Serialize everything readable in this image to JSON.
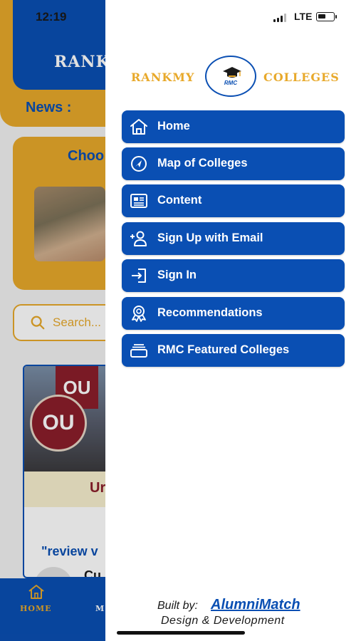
{
  "status_bar": {
    "time": "12:19",
    "network": "LTE",
    "battery_level": 0.55
  },
  "background": {
    "header_logo_text": "RANK",
    "news_label": "News :",
    "choose_text": "Choo",
    "search_placeholder": "Search...",
    "college_flag_text": "OU",
    "college_logo_text": "OU",
    "college_name": "Ur",
    "review_text": "\"review v",
    "reviewer_name": "Cu",
    "tabs": [
      {
        "label": "HOME",
        "icon": "home-icon",
        "active": true
      },
      {
        "label": "M",
        "icon": "map-icon",
        "active": false
      }
    ]
  },
  "drawer": {
    "brand_left": "RANKMY",
    "brand_right": "COLLEGES",
    "brand_badge": "RMC",
    "menu": [
      {
        "label": "Home",
        "icon": "home-icon"
      },
      {
        "label": "Map of Colleges",
        "icon": "navigation-icon"
      },
      {
        "label": "Content",
        "icon": "newspaper-icon"
      },
      {
        "label": "Sign Up with Email",
        "icon": "add-user-icon"
      },
      {
        "label": "Sign In",
        "icon": "sign-in-icon"
      },
      {
        "label": "Recommendations",
        "icon": "award-icon"
      },
      {
        "label": "RMC Featured Colleges",
        "icon": "collection-icon"
      }
    ],
    "footer": {
      "built_by": "Built by:",
      "company": "AlumniMatch",
      "tagline": "Design & Development"
    }
  },
  "colors": {
    "primary_blue": "#0a4fb3",
    "accent_gold": "#e8a92b"
  }
}
